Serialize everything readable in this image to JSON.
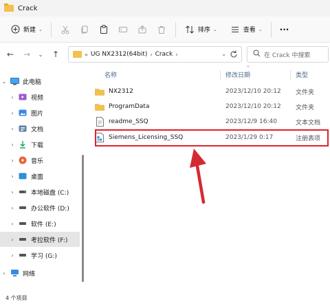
{
  "window": {
    "title": "Crack"
  },
  "toolbar": {
    "new_label": "新建",
    "sort_label": "排序",
    "view_label": "查看",
    "more_label": "···"
  },
  "address": {
    "overflow": "«",
    "crumbs": [
      "UG NX2312(64bit)",
      "Crack"
    ]
  },
  "search": {
    "placeholder": "在 Crack 中搜索"
  },
  "sidebar": {
    "items": [
      {
        "label": "此电脑",
        "icon": "computer-icon",
        "expanded": true
      },
      {
        "label": "视频",
        "icon": "video-folder-icon"
      },
      {
        "label": "图片",
        "icon": "pictures-folder-icon"
      },
      {
        "label": "文档",
        "icon": "documents-folder-icon"
      },
      {
        "label": "下载",
        "icon": "download-icon"
      },
      {
        "label": "音乐",
        "icon": "music-icon"
      },
      {
        "label": "桌面",
        "icon": "desktop-folder-icon"
      },
      {
        "label": "本地磁盘 (C:)",
        "icon": "drive-icon"
      },
      {
        "label": "办公软件 (D:)",
        "icon": "drive-icon"
      },
      {
        "label": "软件 (E:)",
        "icon": "drive-icon"
      },
      {
        "label": "考拉软件 (F:)",
        "icon": "drive-icon",
        "selected": true
      },
      {
        "label": "学习 (G:)",
        "icon": "drive-icon"
      },
      {
        "label": "网络",
        "icon": "network-icon"
      }
    ]
  },
  "columns": {
    "name": "名称",
    "date": "修改日期",
    "type": "类型"
  },
  "files": [
    {
      "name": "NX2312",
      "date": "2023/12/10 20:12",
      "type": "文件夹",
      "icon": "folder-icon"
    },
    {
      "name": "ProgramData",
      "date": "2023/12/10 20:12",
      "type": "文件夹",
      "icon": "folder-icon"
    },
    {
      "name": "readme_SSQ",
      "date": "2023/12/9 16:40",
      "type": "文本文档",
      "icon": "text-file-icon"
    },
    {
      "name": "Siemens_Licensing_SSQ",
      "date": "2023/1/29 0:17",
      "type": "注册表项",
      "icon": "registry-file-icon"
    }
  ],
  "status": {
    "count": "4 个项目"
  },
  "colors": {
    "highlight": "#e0212a",
    "arrow": "#d42a33",
    "folder": "#f2c14e"
  }
}
